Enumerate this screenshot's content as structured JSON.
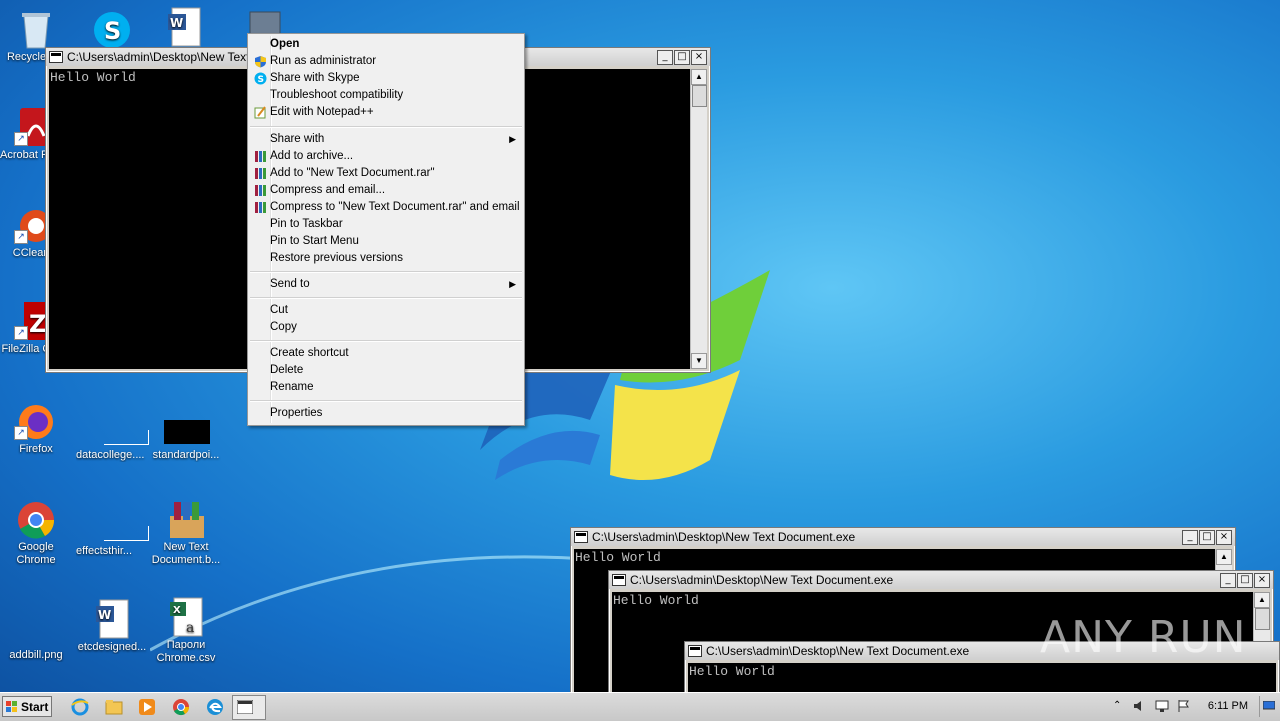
{
  "desktop": {
    "icons": [
      {
        "label": "Recycle Bin",
        "name": "recycle-bin"
      },
      {
        "label": "Acrobat Reader",
        "name": "acrobat-reader"
      },
      {
        "label": "CCleaner",
        "name": "ccleaner"
      },
      {
        "label": "FileZilla Client",
        "name": "filezilla"
      },
      {
        "label": "Firefox",
        "name": "firefox"
      },
      {
        "label": "Google Chrome",
        "name": "google-chrome"
      },
      {
        "label": "addbill.png",
        "name": "addbill-file"
      },
      {
        "label": "Skype",
        "name": "skype"
      },
      {
        "label": "datacollege....",
        "name": "datacollege-file"
      },
      {
        "label": "effectsthir...",
        "name": "effectsthir-file"
      },
      {
        "label": "etcdesigned...",
        "name": "etcdesigned-file"
      },
      {
        "label": "standardpoi...",
        "name": "standardpoi-file"
      },
      {
        "label": "New Text Document.b...",
        "name": "new-text-document-archive"
      },
      {
        "label": "Пароли Chrome.csv",
        "name": "chrome-passwords-csv"
      }
    ]
  },
  "console_main": {
    "title": "C:\\Users\\admin\\Desktop\\New Text Document.exe",
    "output": "Hello World"
  },
  "console_2": {
    "title": "C:\\Users\\admin\\Desktop\\New Text Document.exe",
    "output": "Hello World"
  },
  "console_3": {
    "title": "C:\\Users\\admin\\Desktop\\New Text Document.exe",
    "output": "Hello World"
  },
  "console_4": {
    "title": "C:\\Users\\admin\\Desktop\\New Text Document.exe",
    "output": "Hello World"
  },
  "window_buttons": {
    "minimize": "_",
    "maximize": "□",
    "close": "×"
  },
  "context_menu": {
    "items": [
      {
        "label": "Open",
        "bold": true
      },
      {
        "label": "Run as administrator",
        "icon": "uac-shield-icon"
      },
      {
        "label": "Share with Skype",
        "icon": "skype-icon"
      },
      {
        "label": "Troubleshoot compatibility"
      },
      {
        "label": "Edit with Notepad++",
        "icon": "notepadpp-icon"
      },
      {
        "label": "Share with",
        "submenu": true
      },
      {
        "label": "Add to archive...",
        "icon": "winrar-icon"
      },
      {
        "label": "Add to \"New Text Document.rar\"",
        "icon": "winrar-icon"
      },
      {
        "label": "Compress and email...",
        "icon": "winrar-icon"
      },
      {
        "label": "Compress to \"New Text Document.rar\" and email",
        "icon": "winrar-icon"
      },
      {
        "label": "Pin to Taskbar"
      },
      {
        "label": "Pin to Start Menu"
      },
      {
        "label": "Restore previous versions"
      },
      {
        "label": "Send to",
        "submenu": true
      },
      {
        "label": "Cut"
      },
      {
        "label": "Copy"
      },
      {
        "label": "Create shortcut"
      },
      {
        "label": "Delete"
      },
      {
        "label": "Rename"
      },
      {
        "label": "Properties"
      }
    ]
  },
  "taskbar": {
    "start_label": "Start",
    "clock": "6:11 PM",
    "pinned": [
      "internet-explorer-icon",
      "file-explorer-icon",
      "media-player-icon",
      "chrome-icon",
      "edge-icon",
      "console-icon"
    ]
  },
  "watermark": "ANY RUN"
}
